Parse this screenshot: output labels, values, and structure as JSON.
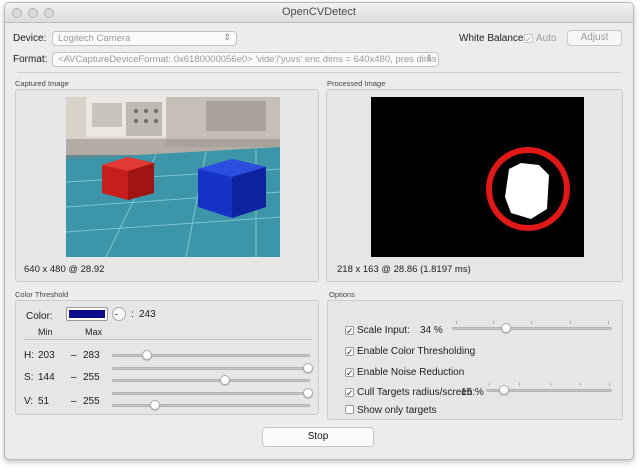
{
  "window": {
    "title": "OpenCVDetect"
  },
  "device": {
    "label": "Device:",
    "value": "Logitech Camera"
  },
  "format": {
    "label": "Format:",
    "value": "<AVCaptureDeviceFormat: 0x6180000056e0> 'vide'/'yuvs' enc dims = 640x480, pres dims = 640x..."
  },
  "white_balance": {
    "label": "White Balance:",
    "auto_label": "Auto",
    "auto_checked": true,
    "adjust_label": "Adjust"
  },
  "captured": {
    "title": "Captured Image",
    "info": "640 x 480 @ 28.92"
  },
  "processed": {
    "title": "Processed Image",
    "info": "218 x 163 @ 28.86 (1.8197 ms)"
  },
  "threshold": {
    "title": "Color Threshold",
    "color_label": "Color:",
    "swatch_color": "#0a0a8a",
    "hue_value": "243",
    "hue_separator": ":",
    "min_header": "Min",
    "max_header": "Max",
    "rows": [
      {
        "label": "H:",
        "min": "203",
        "sep": "–",
        "max": "283",
        "slider_top": 0.44,
        "slider_bottom_min": null
      },
      {
        "label": "S:",
        "min": "144",
        "sep": "–",
        "max": "255",
        "slider_top": 1.0,
        "slider_bottom": 0.58
      },
      {
        "label": "V:",
        "min": "51",
        "sep": "–",
        "max": "255",
        "slider_top": 1.0,
        "slider_bottom": 0.2
      }
    ],
    "h_slider": 0.17
  },
  "options": {
    "title": "Options",
    "scale_input": {
      "label": "Scale Input:",
      "value": "34 %",
      "checked": true,
      "level": 0.34
    },
    "enable_color": {
      "label": "Enable Color Thresholding",
      "checked": true
    },
    "enable_noise": {
      "label": "Enable Noise Reduction",
      "checked": true
    },
    "cull_targets": {
      "label": "Cull Targets radius/screen:",
      "value": "15 %",
      "checked": true,
      "level": 0.15
    },
    "show_only": {
      "label": "Show only targets",
      "checked": false
    }
  },
  "stop_label": "Stop",
  "colors": {
    "accent_red": "#e01818",
    "swatch_blue": "#0a0a8a"
  }
}
